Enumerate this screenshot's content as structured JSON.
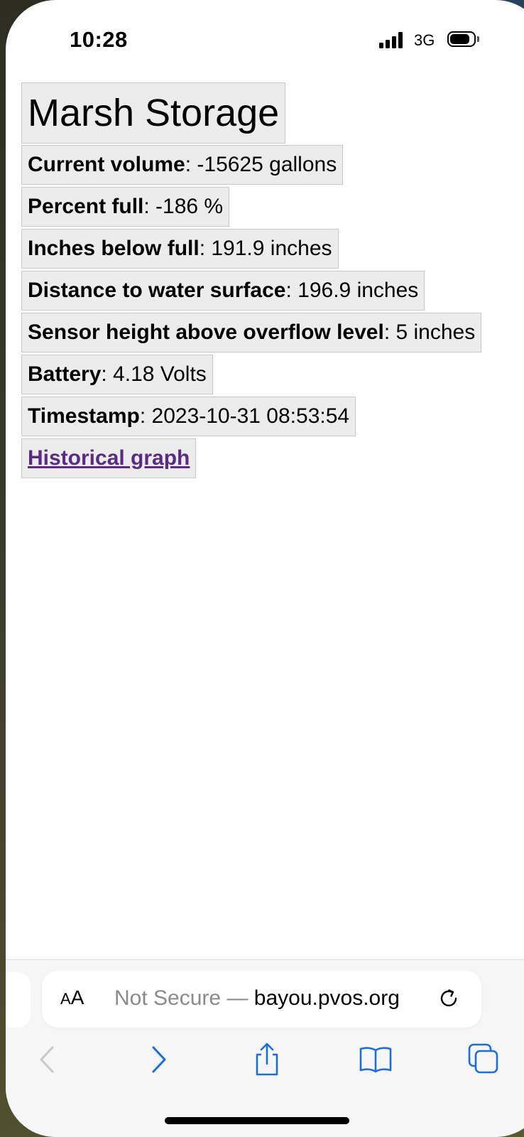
{
  "status_bar": {
    "time": "10:28",
    "network": "3G",
    "battery_level": 0.85
  },
  "page": {
    "title": "Marsh Storage",
    "fields": [
      {
        "label": "Current volume",
        "value": ": -15625 gallons"
      },
      {
        "label": "Percent full",
        "value": ": -186 %"
      },
      {
        "label": "Inches below full",
        "value": ": 191.9 inches"
      },
      {
        "label": "Distance to water surface",
        "value": ": 196.9 inches"
      },
      {
        "label": "Sensor height above overflow level",
        "value": ": 5 inches"
      },
      {
        "label": "Battery",
        "value": ": 4.18 Volts"
      },
      {
        "label": "Timestamp",
        "value": ": 2023-10-31 08:53:54"
      }
    ],
    "link": "Historical graph"
  },
  "browser": {
    "text_size_button": {
      "small": "A",
      "large": "A"
    },
    "security_label": "Not Secure —",
    "domain": "bayou.pvos.org",
    "icons": {
      "reload": "reload-icon",
      "back": "chevron-left-icon",
      "forward": "chevron-right-icon",
      "share": "share-icon",
      "bookmarks": "book-icon",
      "tabs": "tabs-icon"
    },
    "accent_color": "#1a6fe0",
    "disabled_color": "#c7c7cc"
  }
}
